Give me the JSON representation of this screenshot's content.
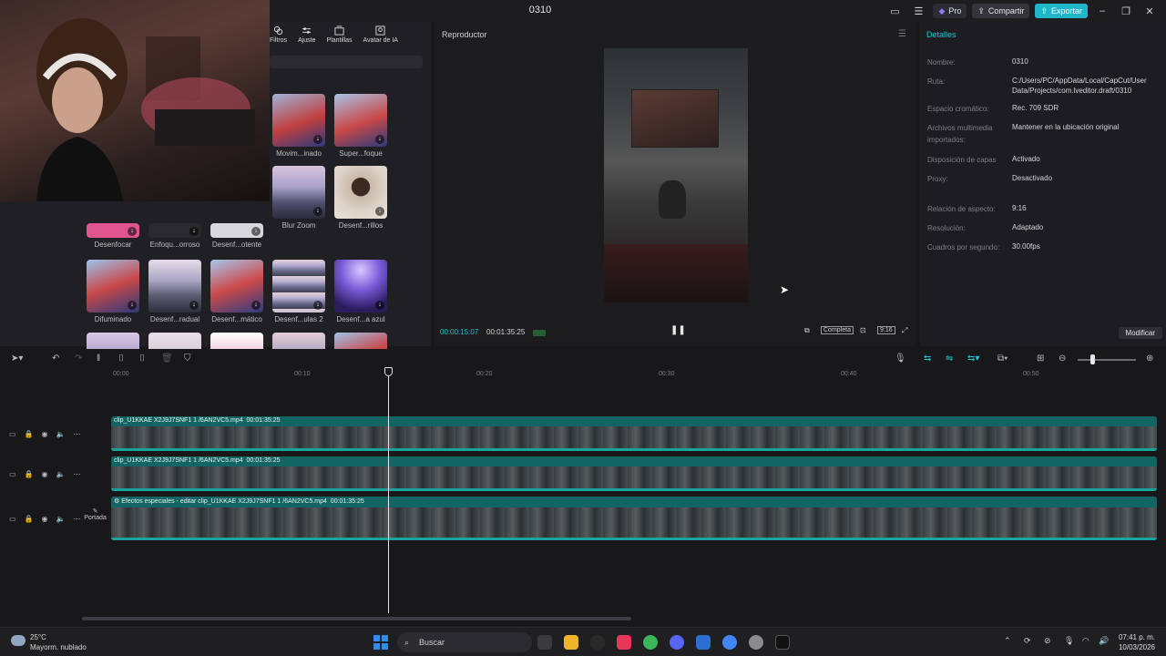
{
  "window": {
    "title": "0310",
    "pro_label": "Pro",
    "share_label": "Compartir",
    "export_label": "Exportar"
  },
  "media_tabs": [
    {
      "label": "Filtros",
      "icon": "filters-icon"
    },
    {
      "label": "Ajuste",
      "icon": "adjust-icon"
    },
    {
      "label": "Plantillas",
      "icon": "templates-icon"
    },
    {
      "label": "Avatar de IA",
      "icon": "ai-avatar-icon"
    }
  ],
  "effects": [
    {
      "label": "Movim...inado"
    },
    {
      "label": "Super...foque"
    },
    {
      "label": "Blur Zoom"
    },
    {
      "label": "Desenf...rillos"
    },
    {
      "label": "Desenfocar"
    },
    {
      "label": "Enfoqu...orroso"
    },
    {
      "label": "Desenf...otente"
    },
    {
      "label": "Difuminado"
    },
    {
      "label": "Desenf...radual"
    },
    {
      "label": "Desenf...mático"
    },
    {
      "label": "Desenf...ulas 2"
    },
    {
      "label": "Desenf...a azul"
    },
    {
      "label": ""
    },
    {
      "label": ""
    },
    {
      "label": ""
    },
    {
      "label": ""
    },
    {
      "label": ""
    }
  ],
  "player": {
    "title": "Reproductor",
    "current_time": "00:00:15:07",
    "total_time": "00:01:35:25",
    "full_label": "Completa",
    "ratio_label": "9:16"
  },
  "details": {
    "title": "Detalles",
    "rows": [
      {
        "key": "Nombre:",
        "value": "0310"
      },
      {
        "key": "Ruta:",
        "value": "C:/Users/PC/AppData/Local/CapCut/User Data/Projects/com.lveditor.draft/0310"
      },
      {
        "key": "Espacio cromático:",
        "value": "Rec. 709 SDR"
      },
      {
        "key": "Archivos multimedia importados:",
        "value": "Mantener en la ubicación original"
      },
      {
        "key": "Disposición de capas",
        "value": "Activado"
      },
      {
        "key": "Proxy:",
        "value": "Desactivado"
      },
      {
        "key": "Relación de aspecto:",
        "value": "9:16"
      },
      {
        "key": "Resolución:",
        "value": "Adaptado"
      },
      {
        "key": "Cuadros por segundo:",
        "value": "30.00fps"
      }
    ],
    "modify_label": "Modificar"
  },
  "timeline": {
    "ruler": [
      "00:00",
      "00:10",
      "00:20",
      "00:30",
      "00:40",
      "00:50"
    ],
    "tracks": [
      {
        "clip": "clip_U1KKAE X2J9J7SNF1 1 /6AN2VC5.mp4",
        "duration": "00:01:35:25"
      },
      {
        "clip": "clip_U1KKAE X2J9J7SNF1 1 /6AN2VC5.mp4",
        "duration": "00:01:35:25"
      },
      {
        "clip": "Efectos especiales - editar  clip_U1KKAE X2J9J7SNF1 1 /6AN2VC5.mp4",
        "duration": "00:01:35:25"
      }
    ],
    "cover_label": "Portada"
  },
  "taskbar": {
    "temperature": "25°C",
    "weather": "Mayorm. nublado",
    "search_placeholder": "Buscar",
    "time": "07:41 p. m.",
    "date": "10/03/2026"
  }
}
